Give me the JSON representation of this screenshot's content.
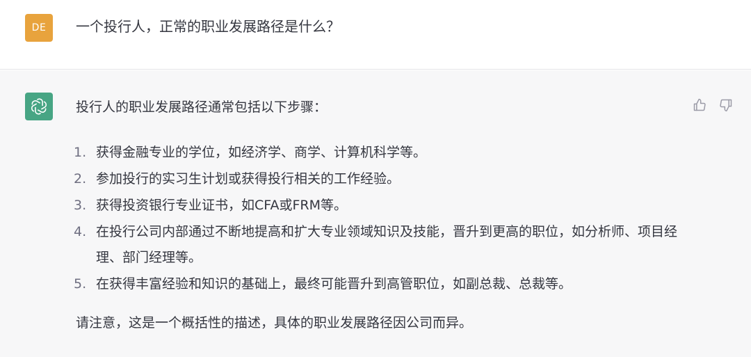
{
  "user": {
    "avatar_initials": "DE",
    "avatar_color": "#e8a33d",
    "message": "一个投行人，正常的职业发展路径是什么？"
  },
  "assistant": {
    "avatar_icon": "openai-logo-icon",
    "avatar_color": "#47a584",
    "intro": "投行人的职业发展路径通常包括以下步骤：",
    "steps": [
      {
        "num": "1.",
        "text": "获得金融专业的学位，如经济学、商学、计算机科学等。"
      },
      {
        "num": "2.",
        "text": "参加投行的实习生计划或获得投行相关的工作经验。"
      },
      {
        "num": "3.",
        "text": "获得投资银行专业证书，如CFA或FRM等。"
      },
      {
        "num": "4.",
        "text": "在投行公司内部通过不断地提高和扩大专业领域知识及技能，晋升到更高的职位，如分析师、项目经理、部门经理等。"
      },
      {
        "num": "5.",
        "text": "在获得丰富经验和知识的基础上，最终可能晋升到高管职位，如副总裁、总裁等。"
      }
    ],
    "note": "请注意，这是一个概括性的描述，具体的职业发展路径因公司而异。"
  },
  "feedback": {
    "thumbs_up_icon": "thumbs-up-icon",
    "thumbs_down_icon": "thumbs-down-icon"
  }
}
